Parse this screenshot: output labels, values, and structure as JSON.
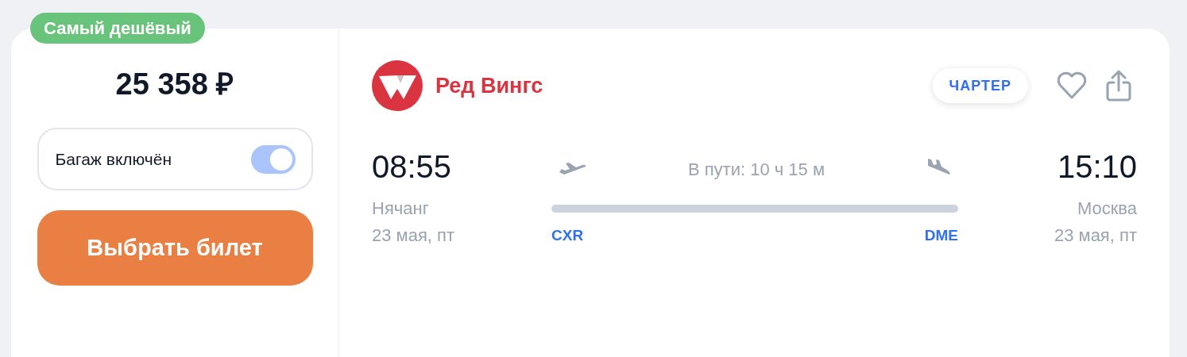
{
  "badge": {
    "label": "Самый дешёвый"
  },
  "price": "25 358 ₽",
  "baggage": {
    "label": "Багаж включён",
    "on": true
  },
  "buy_button": {
    "label": "Выбрать билет"
  },
  "airline": {
    "name": "Ред Вингс"
  },
  "tag": {
    "label": "ЧАРТЕР"
  },
  "duration": "В пути: 10 ч 15 м",
  "departure": {
    "time": "08:55",
    "city": "Нячанг",
    "date": "23 мая, пт",
    "airport": "CXR"
  },
  "arrival": {
    "time": "15:10",
    "city": "Москва",
    "date": "23 мая, пт",
    "airport": "DME"
  }
}
